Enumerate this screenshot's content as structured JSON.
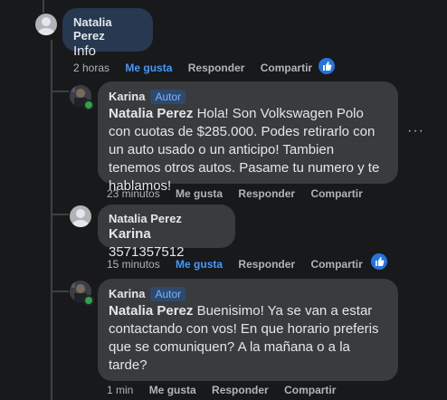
{
  "top_meta": {
    "text": "· · · · · · · · · · · ·"
  },
  "comments": [
    {
      "author": "Natalia Perez",
      "badge": "",
      "mention": "",
      "text": "Info",
      "time": "2 horas",
      "like": "Me gusta",
      "like_active": true,
      "reply": "Responder",
      "share": "Compartir",
      "has_reaction": true
    },
    {
      "author": "Karina",
      "badge": "Autor",
      "mention": "Natalia Perez",
      "text": "Hola! Son Volkswagen Polo con cuotas de $285.000. Podes retirarlo con un auto usado o un anticipo! Tambien tenemos otros autos. Pasame tu numero y te hablamos!",
      "time": "23 minutos",
      "like": "Me gusta",
      "like_active": false,
      "reply": "Responder",
      "share": "Compartir",
      "has_reaction": false
    },
    {
      "author": "Natalia Perez",
      "badge": "",
      "mention": "Karina",
      "text": "3571357512",
      "time": "15 minutos",
      "like": "Me gusta",
      "like_active": true,
      "reply": "Responder",
      "share": "Compartir",
      "has_reaction": true
    },
    {
      "author": "Karina",
      "badge": "Autor",
      "mention": "Natalia Perez",
      "text": "Buenisimo! Ya se van a estar contactando con vos! En que horario preferis que se comuniquen? A la mañana o a la tarde?",
      "time": "1 min",
      "like": "Me gusta",
      "like_active": false,
      "reply": "Responder",
      "share": "Compartir",
      "has_reaction": false
    }
  ],
  "more_options": "···",
  "colors": {
    "background": "#18191a",
    "highlight_bubble": "#263951",
    "bubble": "#3a3b3c",
    "link": "#4599ff",
    "online": "#31a24c"
  }
}
